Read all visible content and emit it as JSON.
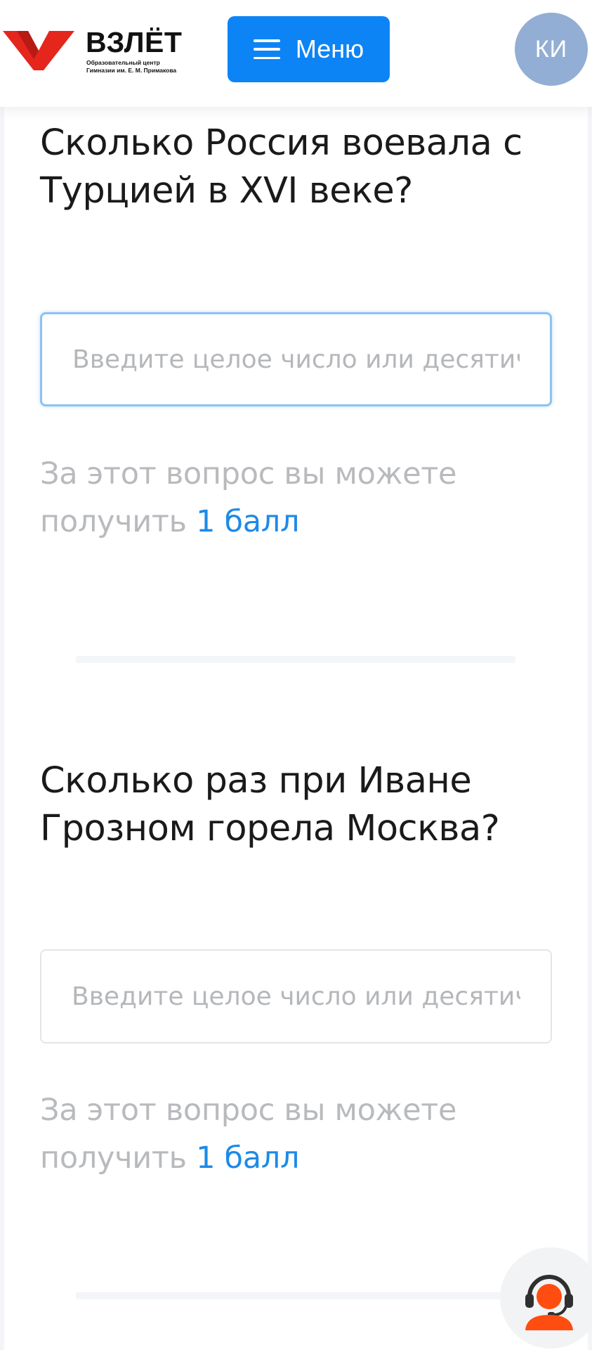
{
  "header": {
    "logo_title": "ВЗЛЁТ",
    "logo_subtitle_line1": "Образовательный центр",
    "logo_subtitle_line2": "Гимназии им. Е. М. Примакова",
    "menu_label": "Меню",
    "avatar_initials": "КИ"
  },
  "questions": [
    {
      "text_line1": "Сколько Россия воевала с",
      "text_line2": "Турцией в XVI веке?",
      "placeholder": "Введите целое число или десятичн",
      "points_prefix": "За этот вопрос вы можете",
      "points_prefix2": "получить",
      "points_value": "1 балл"
    },
    {
      "text_line1": "Сколько раз при Иване",
      "text_line2": "Грозном горела Москва?",
      "placeholder": "Введите целое число или десятичн",
      "points_prefix": "За этот вопрос вы можете",
      "points_prefix2": "получить",
      "points_value": "1 балл"
    }
  ],
  "colors": {
    "accent": "#0d84f5",
    "points_value": "#1d8ae8",
    "logo_red": "#e4261c",
    "support_orange": "#ff4d12",
    "avatar_bg": "#93aed4"
  },
  "icons": {
    "menu": "hamburger-icon",
    "support": "support-headset-icon"
  }
}
